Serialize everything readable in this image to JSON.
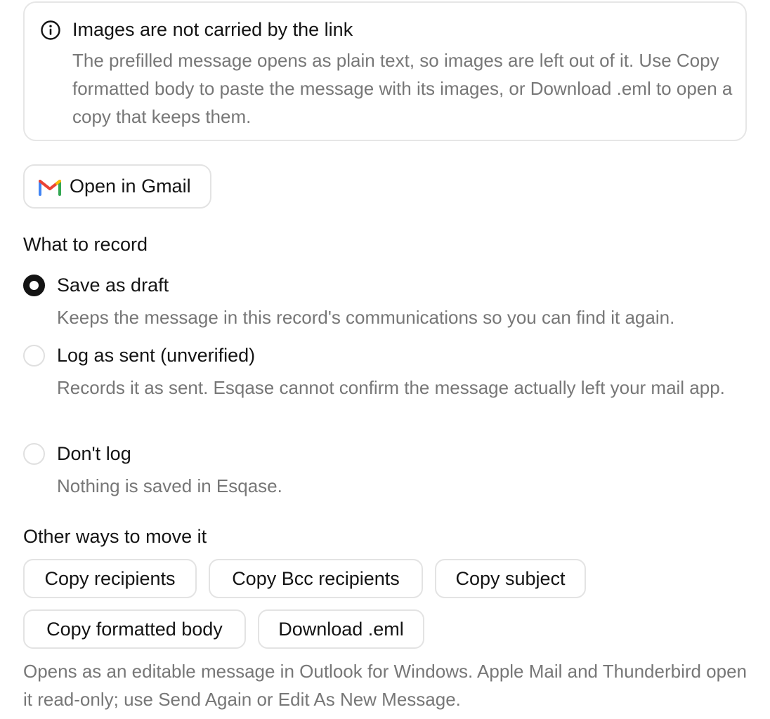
{
  "notice": {
    "icon": "info-icon",
    "title": "Images are not carried by the link",
    "body": "The prefilled message opens as plain text, so images are left out of it. Use Copy formatted body to paste the message with its images, or Download .eml to open a copy that keeps them."
  },
  "gmail_button": {
    "icon": "gmail-icon",
    "label": "Open in Gmail",
    "colors": {
      "red": "#EA4335",
      "blue": "#4285F4",
      "green": "#34A853",
      "yellow": "#FBBC04"
    }
  },
  "record": {
    "title": "What to record",
    "options": [
      {
        "label": "Save as draft",
        "description": "Keeps the message in this record's communications so you can find it again.",
        "checked": true
      },
      {
        "label": "Log as sent (unverified)",
        "description": "Records it as sent. Esqase cannot confirm the message actually left your mail app.",
        "checked": false
      },
      {
        "label": "Don't log",
        "description": "Nothing is saved in Esqase.",
        "checked": false
      }
    ]
  },
  "other": {
    "title": "Other ways to move it",
    "buttons": {
      "copy_recipients": "Copy recipients",
      "copy_bcc": "Copy Bcc recipients",
      "copy_subject": "Copy subject",
      "copy_formatted": "Copy formatted body",
      "download_eml": "Download .eml"
    },
    "footnote": "Opens as an editable message in Outlook for Windows. Apple Mail and Thunderbird open it read-only; use Send Again or Edit As New Message."
  }
}
